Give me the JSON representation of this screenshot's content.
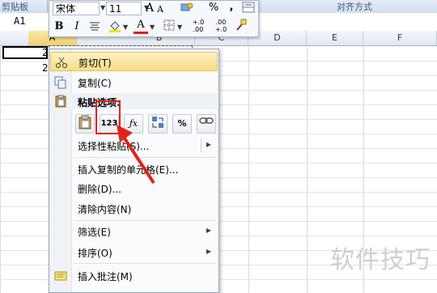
{
  "ribbon": {
    "group_clipboard": "剪贴板",
    "group_alignment": "对齐方式"
  },
  "name_box": {
    "value": "A1"
  },
  "columns": [
    "A",
    "B",
    "C",
    "D",
    "E",
    "F"
  ],
  "cells": {
    "a1_partial": "2",
    "a2_partial": "2"
  },
  "mini_toolbar": {
    "font_name": "宋体",
    "font_size": "11",
    "grow_font": "A",
    "shrink_font": "A",
    "percent": "%",
    "comma": ",",
    "bold": "B",
    "italic": "I",
    "font_color": "A",
    "increase_decimal": "+.0\n.00",
    "decrease_decimal": ".00\n+.0"
  },
  "context_menu": {
    "items": [
      {
        "label": "剪切(T)",
        "highlighted": true
      },
      {
        "label": "复制(C)"
      },
      {
        "label": "粘贴选项:"
      },
      {
        "label": "选择性粘贴(S)...",
        "submenu": true
      },
      {
        "label": "插入复制的单元格(E)..."
      },
      {
        "label": "删除(D)..."
      },
      {
        "label": "清除内容(N)"
      },
      {
        "label": "筛选(E)",
        "submenu": true
      },
      {
        "label": "排序(O)",
        "submenu": true
      },
      {
        "label": "插入批注(M)"
      }
    ],
    "paste_options": [
      "paste-icon",
      "values-123-icon",
      "formulas-fx-icon",
      "transpose-icon",
      "formatting-percent-icon",
      "paste-link-icon"
    ],
    "paste_values_label": "123"
  },
  "watermark": "软件技巧",
  "colors": {
    "highlight": "#f8dd86",
    "annotation_red": "#e0231a",
    "selected_column": "#f1cf6c"
  }
}
